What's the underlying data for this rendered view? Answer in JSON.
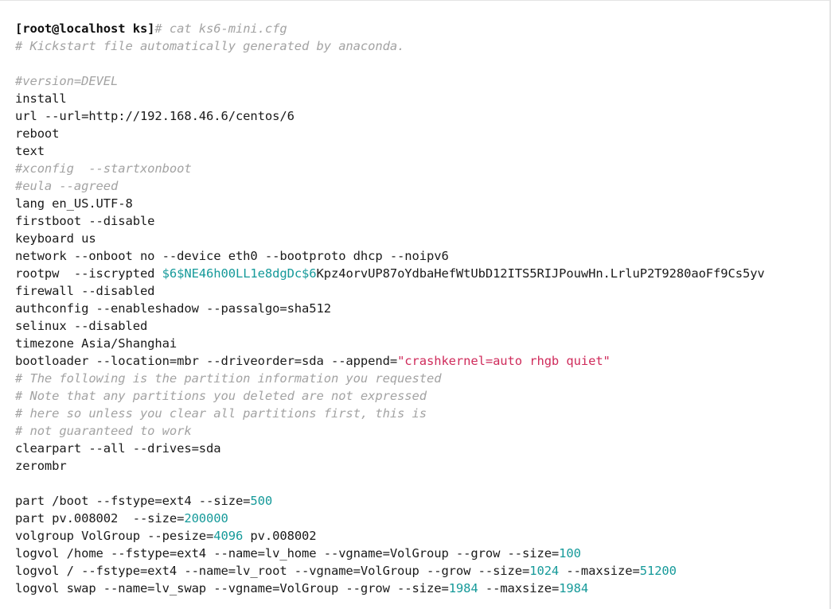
{
  "terminal": {
    "prompt": "[root@localhost ks]",
    "command_marker": "# cat ks6-mini.cfg",
    "filename": "ks6-mini.cfg",
    "colors": {
      "background": "#ffffff",
      "foreground": "#1a1a1a",
      "comment": "#a3a3a3",
      "number": "#169a9a",
      "hash_prefix": "#169a9a",
      "string": "#cf2b5b",
      "border": "#e4e4e4"
    },
    "lines": [
      {
        "id": "line-prompt",
        "type": "prompt",
        "tokens": [
          {
            "cls": "tok-prompt",
            "text": "[root@localhost ks]"
          },
          {
            "cls": "tok-comment",
            "text": "# cat ks6-mini.cfg"
          }
        ]
      },
      {
        "id": "line-header-comment",
        "type": "comment",
        "tokens": [
          {
            "cls": "tok-comment",
            "text": "# Kickstart file automatically generated by anaconda."
          }
        ]
      },
      {
        "id": "line-blank-1",
        "type": "blank",
        "tokens": []
      },
      {
        "id": "line-version",
        "type": "comment",
        "tokens": [
          {
            "cls": "tok-comment",
            "text": "#version=DEVEL"
          }
        ]
      },
      {
        "id": "line-install",
        "type": "directive",
        "tokens": [
          {
            "cls": "tok-plain",
            "text": "install"
          }
        ]
      },
      {
        "id": "line-url",
        "type": "directive",
        "tokens": [
          {
            "cls": "tok-plain",
            "text": "url --url=http://192.168.46.6/centos/6"
          }
        ]
      },
      {
        "id": "line-reboot",
        "type": "directive",
        "tokens": [
          {
            "cls": "tok-plain",
            "text": "reboot"
          }
        ]
      },
      {
        "id": "line-text",
        "type": "directive",
        "tokens": [
          {
            "cls": "tok-plain",
            "text": "text"
          }
        ]
      },
      {
        "id": "line-xconfig",
        "type": "comment",
        "tokens": [
          {
            "cls": "tok-comment",
            "text": "#xconfig  --startxonboot"
          }
        ]
      },
      {
        "id": "line-eula",
        "type": "comment",
        "tokens": [
          {
            "cls": "tok-comment",
            "text": "#eula --agreed"
          }
        ]
      },
      {
        "id": "line-lang",
        "type": "directive",
        "tokens": [
          {
            "cls": "tok-plain",
            "text": "lang en_US.UTF-8"
          }
        ]
      },
      {
        "id": "line-firstboot",
        "type": "directive",
        "tokens": [
          {
            "cls": "tok-plain",
            "text": "firstboot --disable"
          }
        ]
      },
      {
        "id": "line-keyboard",
        "type": "directive",
        "tokens": [
          {
            "cls": "tok-plain",
            "text": "keyboard us"
          }
        ]
      },
      {
        "id": "line-network",
        "type": "directive",
        "tokens": [
          {
            "cls": "tok-plain",
            "text": "network --onboot no --device eth0 --bootproto dhcp --noipv6"
          }
        ]
      },
      {
        "id": "line-rootpw",
        "type": "directive",
        "tokens": [
          {
            "cls": "tok-plain",
            "text": "rootpw  --iscrypted "
          },
          {
            "cls": "tok-hash",
            "text": "$6$NE46h00LL1e8dgDc$6"
          },
          {
            "cls": "tok-plain",
            "text": "Kpz4orvUP87oYdbaHefWtUbD12ITS5RIJPouwHn.LrluP2T9280aoFf9Cs5yv"
          }
        ]
      },
      {
        "id": "line-firewall",
        "type": "directive",
        "tokens": [
          {
            "cls": "tok-plain",
            "text": "firewall --disabled"
          }
        ]
      },
      {
        "id": "line-authconfig",
        "type": "directive",
        "tokens": [
          {
            "cls": "tok-plain",
            "text": "authconfig --enableshadow --passalgo=sha512"
          }
        ]
      },
      {
        "id": "line-selinux",
        "type": "directive",
        "tokens": [
          {
            "cls": "tok-plain",
            "text": "selinux --disabled"
          }
        ]
      },
      {
        "id": "line-timezone",
        "type": "directive",
        "tokens": [
          {
            "cls": "tok-plain",
            "text": "timezone Asia/Shanghai"
          }
        ]
      },
      {
        "id": "line-bootloader",
        "type": "directive",
        "tokens": [
          {
            "cls": "tok-plain",
            "text": "bootloader --location=mbr --driveorder=sda --append="
          },
          {
            "cls": "tok-string",
            "text": "\"crashkernel=auto rhgb quiet\""
          }
        ]
      },
      {
        "id": "line-part-comment-1",
        "type": "comment",
        "tokens": [
          {
            "cls": "tok-comment",
            "text": "# The following is the partition information you requested"
          }
        ]
      },
      {
        "id": "line-part-comment-2",
        "type": "comment",
        "tokens": [
          {
            "cls": "tok-comment",
            "text": "# Note that any partitions you deleted are not expressed"
          }
        ]
      },
      {
        "id": "line-part-comment-3",
        "type": "comment",
        "tokens": [
          {
            "cls": "tok-comment",
            "text": "# here so unless you clear all partitions first, this is"
          }
        ]
      },
      {
        "id": "line-part-comment-4",
        "type": "comment",
        "tokens": [
          {
            "cls": "tok-comment",
            "text": "# not guaranteed to work"
          }
        ]
      },
      {
        "id": "line-clearpart",
        "type": "directive",
        "tokens": [
          {
            "cls": "tok-plain",
            "text": "clearpart --all --drives=sda"
          }
        ]
      },
      {
        "id": "line-zerombr",
        "type": "directive",
        "tokens": [
          {
            "cls": "tok-plain",
            "text": "zerombr"
          }
        ]
      },
      {
        "id": "line-blank-2",
        "type": "blank",
        "tokens": []
      },
      {
        "id": "line-part-boot",
        "type": "directive",
        "tokens": [
          {
            "cls": "tok-plain",
            "text": "part /boot --fstype=ext4 --size="
          },
          {
            "cls": "tok-num",
            "text": "500"
          }
        ]
      },
      {
        "id": "line-part-pv",
        "type": "directive",
        "tokens": [
          {
            "cls": "tok-plain",
            "text": "part pv.008002  --size="
          },
          {
            "cls": "tok-num",
            "text": "200000"
          }
        ]
      },
      {
        "id": "line-volgroup",
        "type": "directive",
        "tokens": [
          {
            "cls": "tok-plain",
            "text": "volgroup VolGroup --pesize="
          },
          {
            "cls": "tok-num",
            "text": "4096"
          },
          {
            "cls": "tok-plain",
            "text": " pv.008002"
          }
        ]
      },
      {
        "id": "line-logvol-home",
        "type": "directive",
        "tokens": [
          {
            "cls": "tok-plain",
            "text": "logvol /home --fstype=ext4 --name=lv_home --vgname=VolGroup --grow --size="
          },
          {
            "cls": "tok-num",
            "text": "100"
          }
        ]
      },
      {
        "id": "line-logvol-root",
        "type": "directive",
        "tokens": [
          {
            "cls": "tok-plain",
            "text": "logvol / --fstype=ext4 --name=lv_root --vgname=VolGroup --grow --size="
          },
          {
            "cls": "tok-num",
            "text": "1024"
          },
          {
            "cls": "tok-plain",
            "text": " --maxsize="
          },
          {
            "cls": "tok-num",
            "text": "51200"
          }
        ]
      },
      {
        "id": "line-logvol-swap",
        "type": "directive",
        "tokens": [
          {
            "cls": "tok-plain",
            "text": "logvol swap --name=lv_swap --vgname=VolGroup --grow --size="
          },
          {
            "cls": "tok-num",
            "text": "1984"
          },
          {
            "cls": "tok-plain",
            "text": " --maxsize="
          },
          {
            "cls": "tok-num",
            "text": "1984"
          }
        ]
      }
    ]
  }
}
